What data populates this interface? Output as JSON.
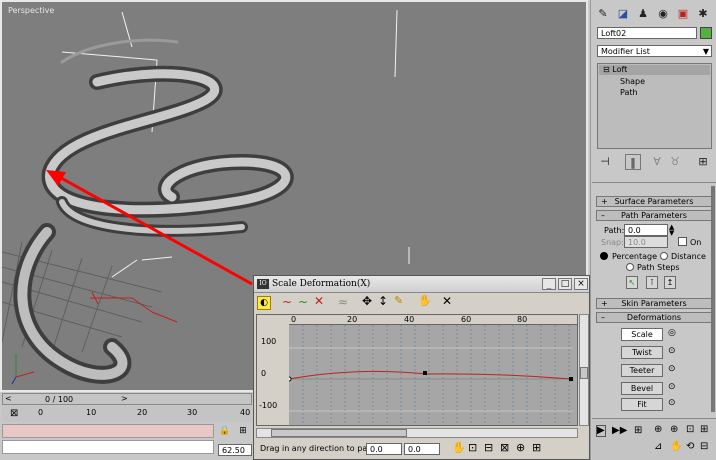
{
  "viewport": {
    "label": "Perspective"
  },
  "command_panel": {
    "object_name": "Loft02",
    "modifier_list": "Modifier List",
    "stack": [
      "Loft",
      "Shape",
      "Path"
    ],
    "rollouts": {
      "surface": "Surface Parameters",
      "path": "Path Parameters",
      "skin": "Skin Parameters",
      "deformations": "Deformations"
    },
    "path_params": {
      "path_label": "Path:",
      "path_value": "0.0",
      "snap_label": "Snap:",
      "snap_value": "10.0",
      "on_label": "On",
      "percentage": "Percentage",
      "distance": "Distance",
      "path_steps": "Path Steps"
    },
    "deformations": [
      "Scale",
      "Twist",
      "Teeter",
      "Bevel",
      "Fit"
    ]
  },
  "timeline": {
    "frame_label": "0 / 100",
    "ticks": [
      "0",
      "10",
      "20",
      "30",
      "40"
    ]
  },
  "status": {
    "value": "62.50"
  },
  "dialog": {
    "title": "Scale Deformation(X)",
    "ruler": [
      "0",
      "20",
      "40",
      "60",
      "80"
    ],
    "y_labels": [
      "100",
      "0",
      "-100"
    ],
    "status_text": "Drag in any direction to pan Ec",
    "field1": "0.0",
    "field2": "0.0"
  }
}
